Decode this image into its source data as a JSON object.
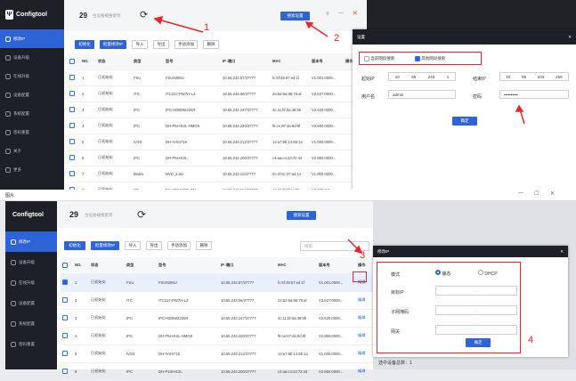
{
  "app": {
    "name": "Configtool"
  },
  "top": {
    "count": "29",
    "subtitle": "台设备被搜索到",
    "settings": "搜索设置",
    "cols": [
      "",
      "NO.",
      "状态",
      "类型",
      "型号",
      "IP↓端口",
      "MAC",
      "版本号",
      "操作"
    ],
    "toolbar": [
      "初始化",
      "批量修改IP",
      "导入",
      "导出",
      "手动添加",
      "删除"
    ],
    "nav": [
      "修改IP",
      "设备升级",
      "在线升级",
      "设备配置",
      "系统配置",
      "密码重置",
      "关于",
      "更多"
    ],
    "rows": [
      {
        "no": "1",
        "st": "已初始化",
        "ty": "FSU",
        "model": "FSU9298U",
        "ip": "10.55.243.57/37777",
        "mac": "fc:5f:49:67:ed:1f",
        "ver": "V1.001.0000..."
      },
      {
        "no": "2",
        "st": "已初始化",
        "ty": "ITC",
        "model": "ITC217-PW7H-LZ",
        "ip": "10.55.243.56/37777",
        "mac": "24:52:6a:86:78:af",
        "ver": "V2.627.0000..."
      },
      {
        "no": "3",
        "st": "已初始化",
        "ty": "IPC",
        "model": "IPC-HDBW2225R",
        "ip": "10.55.243.247/37777",
        "mac": "4c:11:bf:0a:49:9b",
        "ver": "V2.620.0000..."
      },
      {
        "no": "4",
        "st": "已初始化",
        "ty": "IPC",
        "model": "DH-P5H-E2L-HMOS",
        "ip": "10.55.243.220/37777",
        "mac": "f8:ce:07:da:9d:6f",
        "ver": "V2.860.0000..."
      },
      {
        "no": "5",
        "st": "已初始化",
        "ty": "IVSS",
        "model": "DH-IVSS716",
        "ip": "10.55.243.212/37777",
        "mac": "14:a7:8b:14:85:1a",
        "ver": "V1.000.0000..."
      },
      {
        "no": "6",
        "st": "已初始化",
        "ty": "IPC",
        "model": "DH-P5H-E2L",
        "ip": "10.55.243.200/37777",
        "mac": "c4:aa:c4:23:72:43",
        "ver": "V2.850.0000..."
      },
      {
        "no": "7",
        "st": "已初始化",
        "ty": "Matrix",
        "model": "NVD_2.5U",
        "ip": "10.55.243.11/37777",
        "mac": "0c:ef:8c:37:a2:14",
        "ver": "V1.000.0000..."
      },
      {
        "no": "8",
        "st": "已初始化",
        "ty": "SD",
        "model": "DH-SD5C60E-GN",
        "ip": "10.55.243.112/37777",
        "mac": "4c:11:bf:5f:1c:5b",
        "ver": "V2.400.0.0..."
      },
      {
        "no": "9",
        "st": "已初始化",
        "ty": "HCVR",
        "model": "HVR0404FE-S-H",
        "ip": "10.55.243.248/37777",
        "mac": "bc:32:5f:a3:c0:19",
        "ver": "V4.000.0000..."
      }
    ],
    "dialog": {
      "title": "设置",
      "opt1": "当前网段搜索",
      "opt2": "其他网段搜索",
      "start": "起始IP",
      "end": "结束IP",
      "user": "用户名",
      "pwd": "密码",
      "start_ip": [
        "10",
        "55",
        "243",
        "1"
      ],
      "end_ip": [
        "10",
        "55",
        "243",
        "255"
      ],
      "user_val": "admin",
      "pwd_val": "••••••••••",
      "ok": "确定"
    }
  },
  "bottom_title": "图片",
  "bottom": {
    "count": "29",
    "subtitle": "台设备被搜索到",
    "settings": "搜索设置",
    "search_ph": "搜索",
    "toolbar": [
      "初始化",
      "批量修改IP",
      "导入",
      "导出",
      "手动添加",
      "删除"
    ],
    "nav": [
      "修改IP",
      "设备升级",
      "在线升级",
      "设备配置",
      "系统配置",
      "密码重置"
    ],
    "cols": [
      "",
      "NO.",
      "状态",
      "类型",
      "型号",
      "IP↓端口",
      "MAC",
      "版本号",
      "操作"
    ],
    "rows": [
      {
        "no": "1",
        "st": "已初始化",
        "ty": "FSU",
        "model": "FSU9298U",
        "ip": "10.55.243.57/37777",
        "mac": "fc:5f:49:67:ed:1f",
        "ver": "V1.001.0000...",
        "op": "编辑"
      },
      {
        "no": "2",
        "st": "已初始化",
        "ty": "ITC",
        "model": "ITC217-PW7H-LZ",
        "ip": "10.55.243.56/37777",
        "mac": "24:52:6a:86:78:af",
        "ver": "V2.627.0000...",
        "op": "编辑"
      },
      {
        "no": "3",
        "st": "已初始化",
        "ty": "IPC",
        "model": "IPC-HDBW2225R",
        "ip": "10.55.243.247/37777",
        "mac": "4c:11:bf:0a:49:9b",
        "ver": "V2.620.0000...",
        "op": "编辑"
      },
      {
        "no": "4",
        "st": "已初始化",
        "ty": "IPC",
        "model": "DH-P5H-E2L-HMOS",
        "ip": "10.55.243.220/37777",
        "mac": "f8:ce:07:da:9d:6f",
        "ver": "V2.860.0000...",
        "op": "编辑"
      },
      {
        "no": "5",
        "st": "已初始化",
        "ty": "IVSS",
        "model": "DH-IVSS716",
        "ip": "10.55.243.212/37777",
        "mac": "14:a7:8b:14:85:1a",
        "ver": "V1.000.0000...",
        "op": "编辑"
      },
      {
        "no": "6",
        "st": "已初始化",
        "ty": "IPC",
        "model": "DH-P10H-E2L",
        "ip": "10.55.243.200/37777",
        "mac": "c4:aa:c4:23:72:43",
        "ver": "V2.850.0000...",
        "op": "编辑"
      }
    ],
    "dialog": {
      "title": "修改IP",
      "mode": "模式",
      "static": "静态",
      "dhcp": "DHCP",
      "ip": "目标IP",
      "mask": "子网掩码",
      "gw": "网关",
      "ok": "确定"
    },
    "status": "选中设备总数：1"
  },
  "annotations": [
    "1",
    "2",
    "3",
    "4"
  ]
}
